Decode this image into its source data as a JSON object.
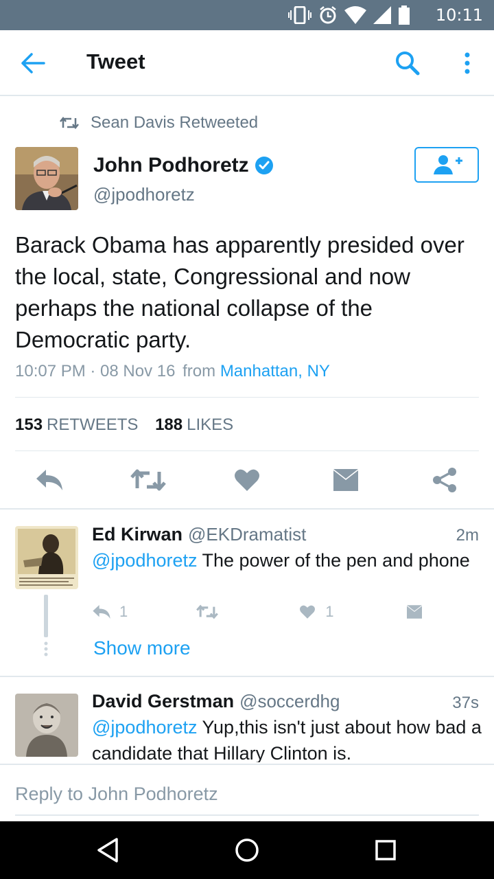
{
  "status_bar": {
    "time": "10:11"
  },
  "header": {
    "title": "Tweet"
  },
  "retweet": {
    "text": "Sean Davis Retweeted"
  },
  "tweet": {
    "name": "John Podhoretz",
    "handle": "@jpodhoretz",
    "text": "Barack Obama has apparently presided over the local, state, Congressional and now perhaps the national collapse of the Democratic party.",
    "timestamp": "10:07 PM · 08 Nov 16",
    "from_label": "from",
    "location": "Manhattan, NY",
    "retweets_count": "153",
    "retweets_label": "RETWEETS",
    "likes_count": "188",
    "likes_label": "LIKES"
  },
  "replies": [
    {
      "name": "Ed Kirwan",
      "handle": "@EKDramatist",
      "time": "2m",
      "mention": "@jpodhoretz",
      "text": " The power of the pen and phone",
      "reply_count": "1",
      "like_count": "1"
    },
    {
      "name": "David Gerstman",
      "handle": "@soccerdhg",
      "time": "37s",
      "mention": "@jpodhoretz",
      "text": " Yup,this isn't just about how bad a candidate that Hillary Clinton is."
    }
  ],
  "show_more": "Show more",
  "compose": {
    "placeholder": "Reply to John Podhoretz"
  },
  "colors": {
    "accent": "#1da1f2",
    "status_bar": "#5f7485",
    "muted": "#657786",
    "icon": "#aab8c2"
  },
  "icons": [
    "back-arrow-icon",
    "search-icon",
    "more-vertical-icon",
    "retweet-icon",
    "verified-icon",
    "follow-icon",
    "reply-icon",
    "like-icon",
    "message-icon",
    "share-icon",
    "nav-back-icon",
    "nav-home-icon",
    "nav-recents-icon"
  ]
}
